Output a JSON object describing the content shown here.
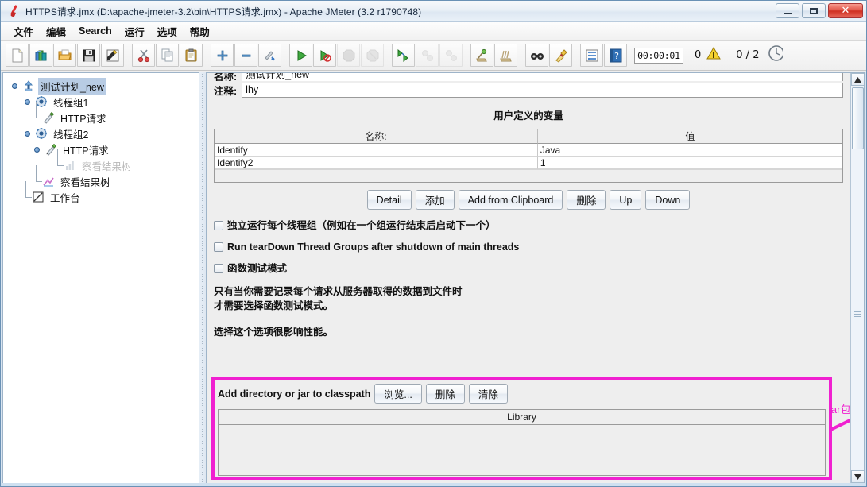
{
  "window": {
    "title": "HTTPS请求.jmx (D:\\apache-jmeter-3.2\\bin\\HTTPS请求.jmx) - Apache JMeter (3.2 r1790748)",
    "app_icon": "jmeter-feather-icon",
    "minimize_label": "—",
    "maximize_label": "□",
    "close_label": "✕"
  },
  "menubar": {
    "items": [
      {
        "label": "文件",
        "name": "menu-file"
      },
      {
        "label": "编辑",
        "name": "menu-edit"
      },
      {
        "label": "Search",
        "name": "menu-search"
      },
      {
        "label": "运行",
        "name": "menu-run"
      },
      {
        "label": "选项",
        "name": "menu-options"
      },
      {
        "label": "帮助",
        "name": "menu-help"
      }
    ]
  },
  "toolbar": {
    "buttons": [
      {
        "name": "new-icon",
        "tooltip": "New"
      },
      {
        "name": "templates-icon",
        "tooltip": "Templates"
      },
      {
        "name": "open-icon",
        "tooltip": "Open"
      },
      {
        "name": "save-icon",
        "tooltip": "Save"
      },
      {
        "name": "save-as-icon",
        "tooltip": "Save As"
      },
      {
        "name": "cut-icon",
        "tooltip": "Cut"
      },
      {
        "name": "copy-icon",
        "tooltip": "Copy"
      },
      {
        "name": "paste-icon",
        "tooltip": "Paste"
      },
      {
        "name": "expand-all-icon",
        "tooltip": "Expand All"
      },
      {
        "name": "collapse-all-icon",
        "tooltip": "Collapse All"
      },
      {
        "name": "toggle-icon",
        "tooltip": "Toggle"
      },
      {
        "name": "start-icon",
        "tooltip": "Start"
      },
      {
        "name": "start-no-pauses-icon",
        "tooltip": "Start no pauses"
      },
      {
        "name": "stop-icon",
        "tooltip": "Stop"
      },
      {
        "name": "shutdown-icon",
        "tooltip": "Shutdown"
      },
      {
        "name": "remote-start-all-icon",
        "tooltip": "Remote Start All"
      },
      {
        "name": "remote-stop-all-icon",
        "tooltip": "Remote Stop All"
      },
      {
        "name": "remote-shutdown-all-icon",
        "tooltip": "Remote Shutdown All"
      },
      {
        "name": "clear-icon",
        "tooltip": "Clear"
      },
      {
        "name": "clear-all-icon",
        "tooltip": "Clear All"
      },
      {
        "name": "search-icon",
        "tooltip": "Search"
      },
      {
        "name": "reset-search-icon",
        "tooltip": "Reset Search"
      },
      {
        "name": "function-helper-icon",
        "tooltip": "Function Helper Dialog"
      },
      {
        "name": "help-icon",
        "tooltip": "Help"
      }
    ],
    "timer": "00:00:01",
    "error_count": "0",
    "warning_icon": "warning-triangle-icon",
    "thread_count": "0 / 2",
    "right_glyph": "gc-icon"
  },
  "tree": {
    "nodes": [
      {
        "label": "测试计划_new",
        "icon": "test-plan-icon",
        "selected": true,
        "disabled": false,
        "depth": 0,
        "name": "tree-node-test-plan"
      },
      {
        "label": "线程组1",
        "icon": "thread-group-icon",
        "selected": false,
        "disabled": false,
        "depth": 1,
        "name": "tree-node-thread-group-1"
      },
      {
        "label": "HTTP请求",
        "icon": "http-request-icon",
        "selected": false,
        "disabled": false,
        "depth": 2,
        "name": "tree-node-http-request-1"
      },
      {
        "label": "线程组2",
        "icon": "thread-group-icon",
        "selected": false,
        "disabled": false,
        "depth": 1,
        "name": "tree-node-thread-group-2"
      },
      {
        "label": "HTTP请求",
        "icon": "http-request-icon",
        "selected": false,
        "disabled": false,
        "depth": 2,
        "name": "tree-node-http-request-2"
      },
      {
        "label": "察看结果树",
        "icon": "view-results-tree-icon",
        "selected": false,
        "disabled": true,
        "depth": 3,
        "name": "tree-node-view-results-tree-disabled"
      },
      {
        "label": "察看结果树",
        "icon": "view-results-tree-icon",
        "selected": false,
        "disabled": false,
        "depth": 1,
        "name": "tree-node-view-results-tree"
      },
      {
        "label": "工作台",
        "icon": "workbench-icon",
        "selected": false,
        "disabled": false,
        "depth": 0,
        "name": "tree-node-workbench"
      }
    ]
  },
  "main": {
    "name_label": "名称:",
    "name_value": "测试计划_new",
    "comment_label": "注释:",
    "comment_value": "lhy",
    "variables_title": "用户定义的变量",
    "table": {
      "headers": [
        "名称:",
        "值"
      ],
      "rows": [
        [
          "Identify",
          "Java"
        ],
        [
          "Identify2",
          "1"
        ]
      ]
    },
    "table_buttons": [
      {
        "label": "Detail",
        "name": "detail-button"
      },
      {
        "label": "添加",
        "name": "add-button"
      },
      {
        "label": "Add from Clipboard",
        "name": "add-from-clipboard-button"
      },
      {
        "label": "删除",
        "name": "delete-button"
      },
      {
        "label": "Up",
        "name": "up-button"
      },
      {
        "label": "Down",
        "name": "down-button"
      }
    ],
    "checkboxes": [
      {
        "label": "独立运行每个线程组（例如在一个组运行结束后启动下一个）",
        "checked": false,
        "name": "checkbox-run-thread-groups-consecutively"
      },
      {
        "label": "Run tearDown Thread Groups after shutdown of main threads",
        "checked": false,
        "name": "checkbox-run-teardown-thread-groups"
      },
      {
        "label": "函数测试模式",
        "checked": false,
        "name": "checkbox-functional-test-mode"
      }
    ],
    "paragraph_line1": "只有当你需要记录每个请求从服务器取得的数据到文件时",
    "paragraph_line2": "才需要选择函数测试模式。",
    "paragraph_line3": "选择这个选项很影响性能。",
    "annotation_text": "添加jar包",
    "annotation_color": "#f020d0",
    "classpath": {
      "label": "Add directory or jar to classpath",
      "buttons": [
        {
          "label": "浏览...",
          "name": "browse-button"
        },
        {
          "label": "删除",
          "name": "classpath-delete-button"
        },
        {
          "label": "清除",
          "name": "classpath-clear-button"
        }
      ],
      "table_header": "Library",
      "rows": []
    }
  }
}
